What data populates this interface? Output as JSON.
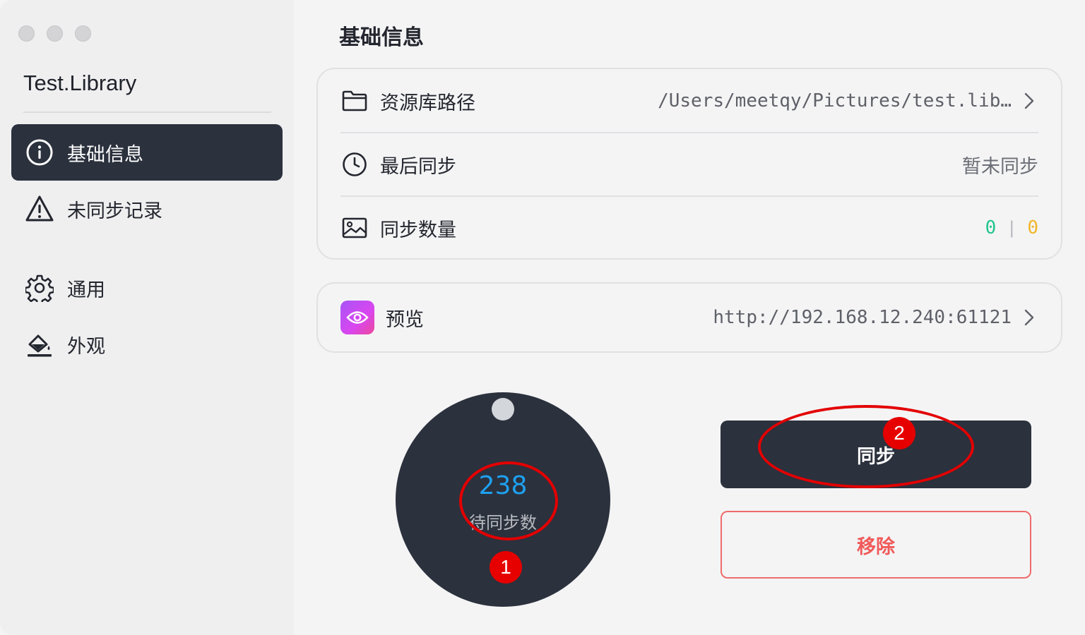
{
  "sidebar": {
    "library_name": "Test.Library",
    "items": [
      {
        "label": "基础信息",
        "icon": "info-icon",
        "active": true
      },
      {
        "label": "未同步记录",
        "icon": "warning-icon",
        "active": false
      },
      {
        "label": "通用",
        "icon": "gear-icon",
        "active": false
      },
      {
        "label": "外观",
        "icon": "paint-bucket-icon",
        "active": false
      }
    ]
  },
  "main": {
    "title": "基础信息",
    "info": {
      "path_label": "资源库路径",
      "path_value": "/Users/meetqy/Pictures/test.lib…",
      "last_sync_label": "最后同步",
      "last_sync_value": "暂未同步",
      "count_label": "同步数量",
      "count_synced": "0",
      "count_separator": "|",
      "count_other": "0"
    },
    "preview": {
      "label": "预览",
      "url": "http://192.168.12.240:61121"
    },
    "dial": {
      "pending_count": "238",
      "pending_label": "待同步数"
    },
    "buttons": {
      "sync_label": "同步",
      "remove_label": "移除"
    },
    "annotations": {
      "badge_1": "1",
      "badge_2": "2"
    }
  },
  "colors": {
    "sidebar_active": "#2b313d",
    "dial_bg": "#2b313d",
    "pending_number": "#1ea1f1",
    "count_green": "#22c58b",
    "count_yellow": "#f0b62a",
    "remove_red": "#f05a5a",
    "annotation_red": "#e30000"
  }
}
